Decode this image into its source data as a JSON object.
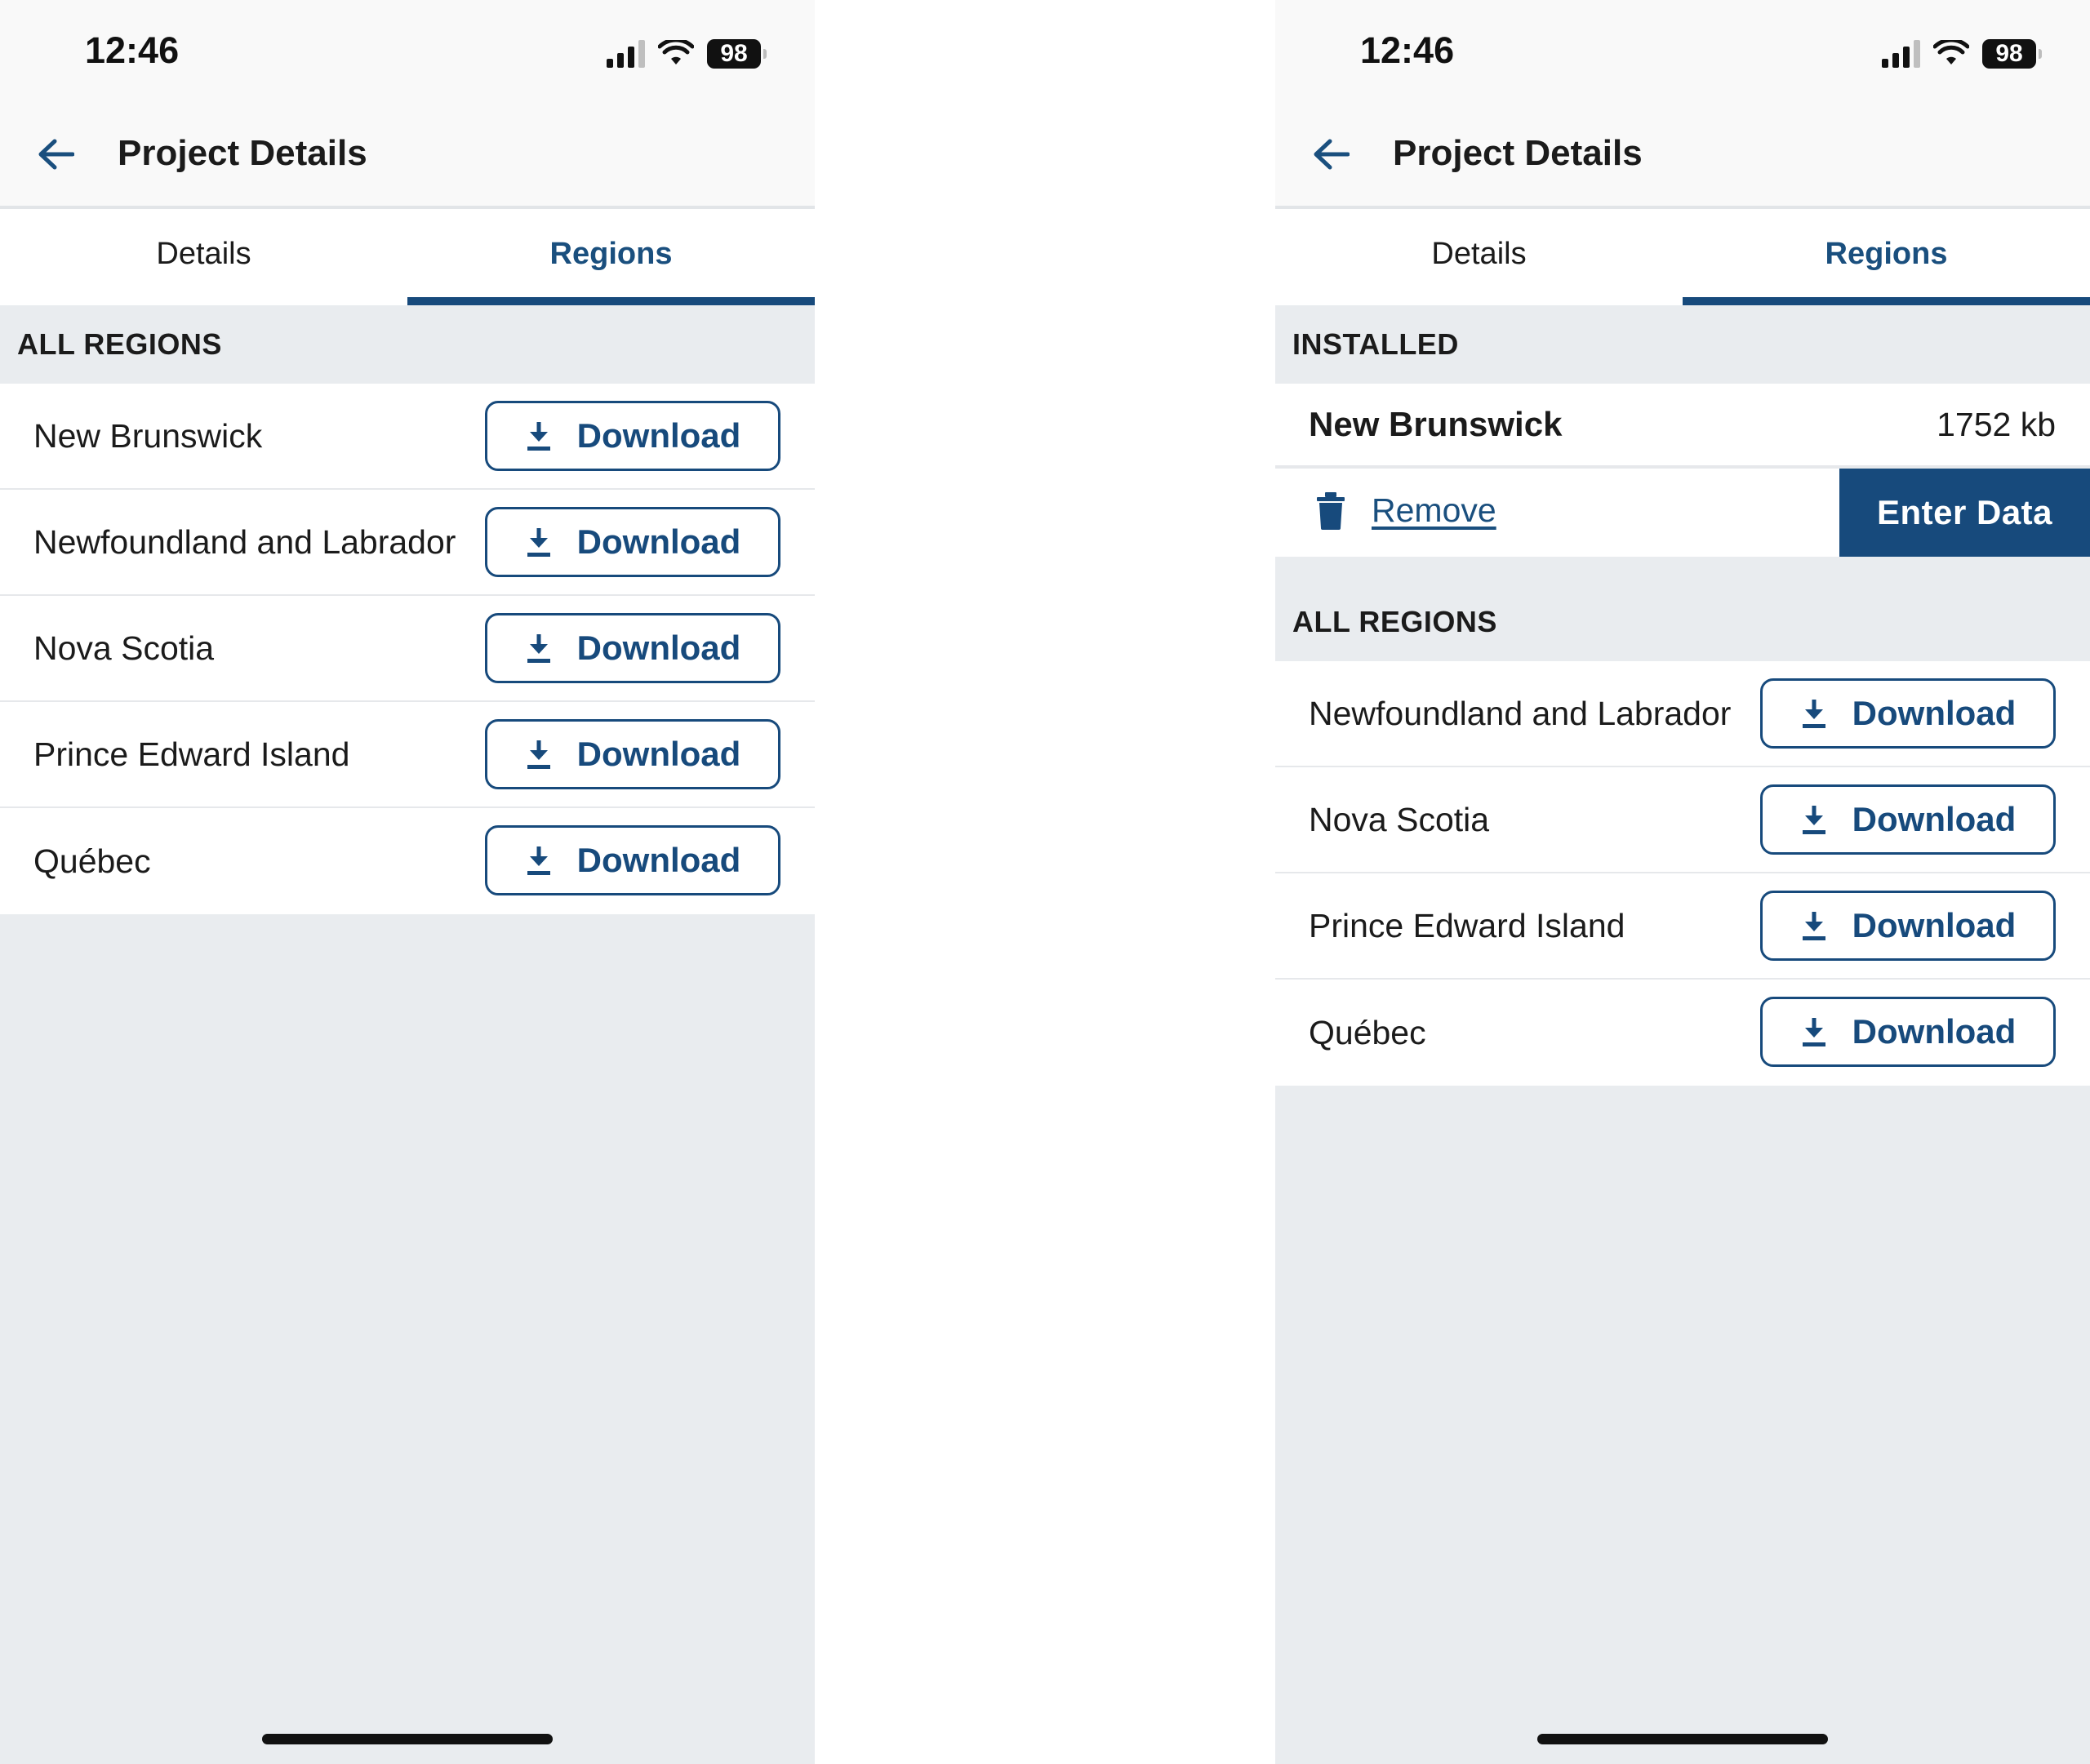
{
  "left": {
    "status": {
      "time": "12:46",
      "battery": "98"
    },
    "header": {
      "title": "Project Details"
    },
    "tabs": [
      {
        "label": "Details"
      },
      {
        "label": "Regions"
      }
    ],
    "all_regions": {
      "title": "ALL REGIONS",
      "items": [
        {
          "name": "New Brunswick",
          "action": "Download"
        },
        {
          "name": "Newfoundland and Labrador",
          "action": "Download"
        },
        {
          "name": "Nova Scotia",
          "action": "Download"
        },
        {
          "name": "Prince Edward Island",
          "action": "Download"
        },
        {
          "name": "Québec",
          "action": "Download"
        }
      ]
    }
  },
  "right": {
    "status": {
      "time": "12:46",
      "battery": "98"
    },
    "header": {
      "title": "Project Details"
    },
    "tabs": [
      {
        "label": "Details"
      },
      {
        "label": "Regions"
      }
    ],
    "installed": {
      "title": "INSTALLED",
      "region": {
        "name": "New Brunswick",
        "size": "1752 kb",
        "remove_label": "Remove",
        "enter_label": "Enter Data"
      }
    },
    "all_regions": {
      "title": "ALL REGIONS",
      "items": [
        {
          "name": "Newfoundland and Labrador",
          "action": "Download"
        },
        {
          "name": "Nova Scotia",
          "action": "Download"
        },
        {
          "name": "Prince Edward Island",
          "action": "Download"
        },
        {
          "name": "Québec",
          "action": "Download"
        }
      ]
    }
  },
  "colors": {
    "primary": "#174a7c",
    "background": "#e9ecef",
    "surface": "#ffffff"
  },
  "icons": {
    "back": "arrow-left-icon",
    "download": "download-icon",
    "remove": "trash-icon",
    "signal": "cellular-signal-icon",
    "wifi": "wifi-icon",
    "battery": "battery-icon"
  }
}
